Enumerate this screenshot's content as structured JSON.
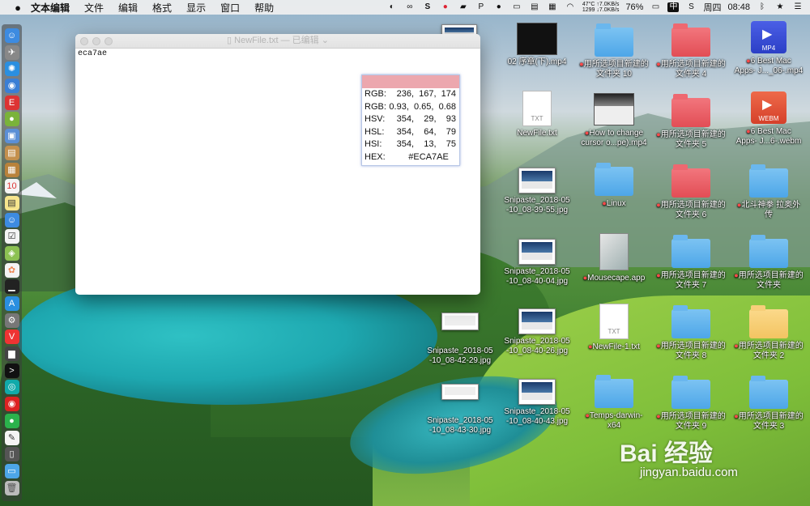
{
  "menubar": {
    "apple": "",
    "items": [
      "文本编辑",
      "文件",
      "编辑",
      "格式",
      "显示",
      "窗口",
      "帮助"
    ],
    "status": {
      "net_up": "7.0KB/s",
      "net_down": "7.0KB/s",
      "temp": "47°C",
      "rpm": "1299",
      "battery": "76%",
      "input": "中",
      "input_s": "S",
      "day": "周四",
      "time": "08:48"
    }
  },
  "window": {
    "title": "NewFile.txt",
    "title_suffix": " — 已编辑 ⌄",
    "content": "eca7ae"
  },
  "color_picker": {
    "swatch_color": "#ECA7AE",
    "rows": [
      {
        "label": "RGB:",
        "value": "236,  167,  174"
      },
      {
        "label": "RGB:",
        "value": "0.93,  0.65,  0.68"
      },
      {
        "label": "HSV:",
        "value": "354,    29,    93"
      },
      {
        "label": "HSL:",
        "value": "354,    64,    79"
      },
      {
        "label": "HSI:",
        "value": "354,    13,    75"
      },
      {
        "label": "HEX:",
        "value": "#ECA7AE   "
      }
    ]
  },
  "desktop": {
    "col_a": [
      {
        "label": "…-05\n….jpg"
      },
      {
        "label": "…-05\n….jpg"
      },
      {
        "label": "…-05\n….jpg"
      }
    ],
    "icons": {
      "i1": {
        "label1": "02 序章(下).mp4",
        "label2": ""
      },
      "i2": {
        "label1": "用所选项目新建的",
        "label2": "文件夹 10"
      },
      "i3": {
        "label1": "用所选项目新建的",
        "label2": "文件夹 4"
      },
      "i4": {
        "label1": "6 Best Mac",
        "label2": "Apps- J..._06-.mp4"
      },
      "i5": {
        "label1": "NewFile.txt",
        "label2": ""
      },
      "i6": {
        "label1": "How to change",
        "label2": "cursor o...pe).mp4"
      },
      "i7": {
        "label1": "用所选项目新建的",
        "label2": "文件夹 5"
      },
      "i8": {
        "label1": "6 Best Mac",
        "label2": "Apps- J...6-.webm"
      },
      "i9": {
        "label1": "Snipaste_2018-05",
        "label2": "-10_08-39-55.jpg"
      },
      "i10": {
        "label1": "Linux",
        "label2": ""
      },
      "i11": {
        "label1": "用所选项目新建的",
        "label2": "文件夹 6"
      },
      "i12": {
        "label1": "北斗神拳 拉奥外",
        "label2": "传"
      },
      "i13": {
        "label1": "Snipaste_2018-05",
        "label2": "-10_08-40-04.jpg"
      },
      "i14": {
        "label1": "Mousecape.app",
        "label2": ""
      },
      "i15": {
        "label1": "用所选项目新建的",
        "label2": "文件夹 7"
      },
      "i16": {
        "label1": "用所选项目新建的",
        "label2": "文件夹"
      },
      "i17": {
        "label1": "Snipaste_2018-05",
        "label2": "-10_08-42-29.jpg"
      },
      "i18": {
        "label1": "Snipaste_2018-05",
        "label2": "-10_08-40-26.jpg"
      },
      "i19": {
        "label1": "NewFile-1.txt",
        "label2": ""
      },
      "i20": {
        "label1": "用所选项目新建的",
        "label2": "文件夹 8"
      },
      "i21": {
        "label1": "用所选项目新建的",
        "label2": "文件夹 2"
      },
      "i22": {
        "label1": "Snipaste_2018-05",
        "label2": "-10_08-43-30.jpg"
      },
      "i23": {
        "label1": "Snipaste_2018-05",
        "label2": "-10_08-40-43.jpg"
      },
      "i24": {
        "label1": "Temps-darwin-",
        "label2": "x64"
      },
      "i25": {
        "label1": "用所选项目新建的",
        "label2": "文件夹 9"
      },
      "i26": {
        "label1": "用所选项目新建的",
        "label2": "文件夹 3"
      }
    },
    "media_tags": {
      "mp4": "MP4",
      "webm": "WEBM",
      "txt": "TXT"
    }
  },
  "watermark": {
    "brand": "Bai 经验",
    "url": "jingyan.baidu.com"
  }
}
